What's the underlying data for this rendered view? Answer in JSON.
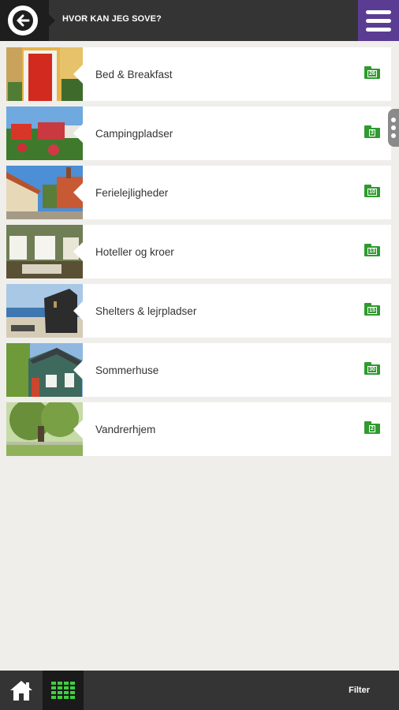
{
  "header": {
    "title": "HVOR KAN JEG SOVE?",
    "back_icon": "arrow-left-icon",
    "menu_icon": "hamburger-icon",
    "menu_color": "#5b3c93"
  },
  "categories": [
    {
      "label": "Bed & Breakfast",
      "count": "26",
      "image": "red-door-photo"
    },
    {
      "label": "Campingpladser",
      "count": "3",
      "image": "campers-photo"
    },
    {
      "label": "Ferielejligheder",
      "count": "10",
      "image": "town-street-photo"
    },
    {
      "label": "Hoteller og kroer",
      "count": "13",
      "image": "hotel-room-photo"
    },
    {
      "label": "Shelters & lejrpladser",
      "count": "15",
      "image": "beach-shelter-photo"
    },
    {
      "label": "Sommerhuse",
      "count": "30",
      "image": "summer-house-photo"
    },
    {
      "label": "Vandrerhjem",
      "count": "2",
      "image": "tree-garden-photo"
    }
  ],
  "footer": {
    "home_icon": "home-icon",
    "grid_icon": "grid-view-icon",
    "filter_label": "Filter",
    "accent": "#3fcf3f"
  }
}
